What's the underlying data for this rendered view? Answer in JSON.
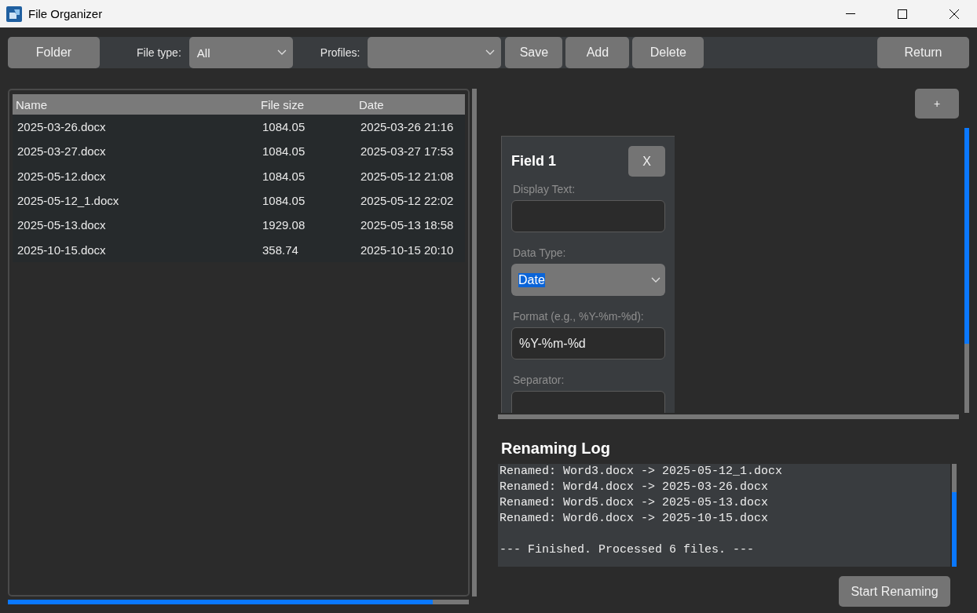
{
  "window": {
    "title": "File Organizer"
  },
  "toolbar": {
    "folder_button": "Folder",
    "file_type": {
      "label": "File type:",
      "value": "All"
    },
    "profiles": {
      "label": "Profiles:"
    },
    "actions": [
      "Save",
      "Add",
      "Delete"
    ],
    "return_button": "Return"
  },
  "file_table": {
    "columns": [
      "Name",
      "File size",
      "Date"
    ],
    "rows": [
      [
        "2025-03-26.docx",
        "1084.05",
        "2025-03-26 21:16"
      ],
      [
        "2025-03-27.docx",
        "1084.05",
        "2025-03-27 17:53"
      ],
      [
        "2025-05-12.docx",
        "1084.05",
        "2025-05-12 21:08"
      ],
      [
        "2025-05-12_1.docx",
        "1084.05",
        "2025-05-12 22:02"
      ],
      [
        "2025-05-13.docx",
        "1929.08",
        "2025-05-13 18:58"
      ],
      [
        "2025-10-15.docx",
        "358.74",
        "2025-10-15 20:10"
      ]
    ]
  },
  "fields_panel": {
    "add_button": "+",
    "fields": [
      {
        "title": "Field 1",
        "remove_button": "X",
        "inputs": [
          {
            "kind": "text",
            "label": "Display Text:"
          },
          {
            "kind": "select",
            "label": "Data Type:",
            "value": "Date",
            "highlighted": true
          },
          {
            "kind": "text",
            "label": "Format (e.g., %Y-%m-%d):",
            "value": "%Y-%m-%d"
          },
          {
            "kind": "text",
            "label": "Separator:"
          }
        ]
      }
    ]
  },
  "log": {
    "title": "Renaming Log",
    "lines": [
      "Renamed: Word3.docx -> 2025-05-12_1.docx",
      "Renamed: Word4.docx -> 2025-03-26.docx",
      "Renamed: Word5.docx -> 2025-05-13.docx",
      "Renamed: Word6.docx -> 2025-10-15.docx"
    ],
    "summary": "--- Finished. Processed 6 files. ---"
  },
  "start_button": "Start Renaming"
}
